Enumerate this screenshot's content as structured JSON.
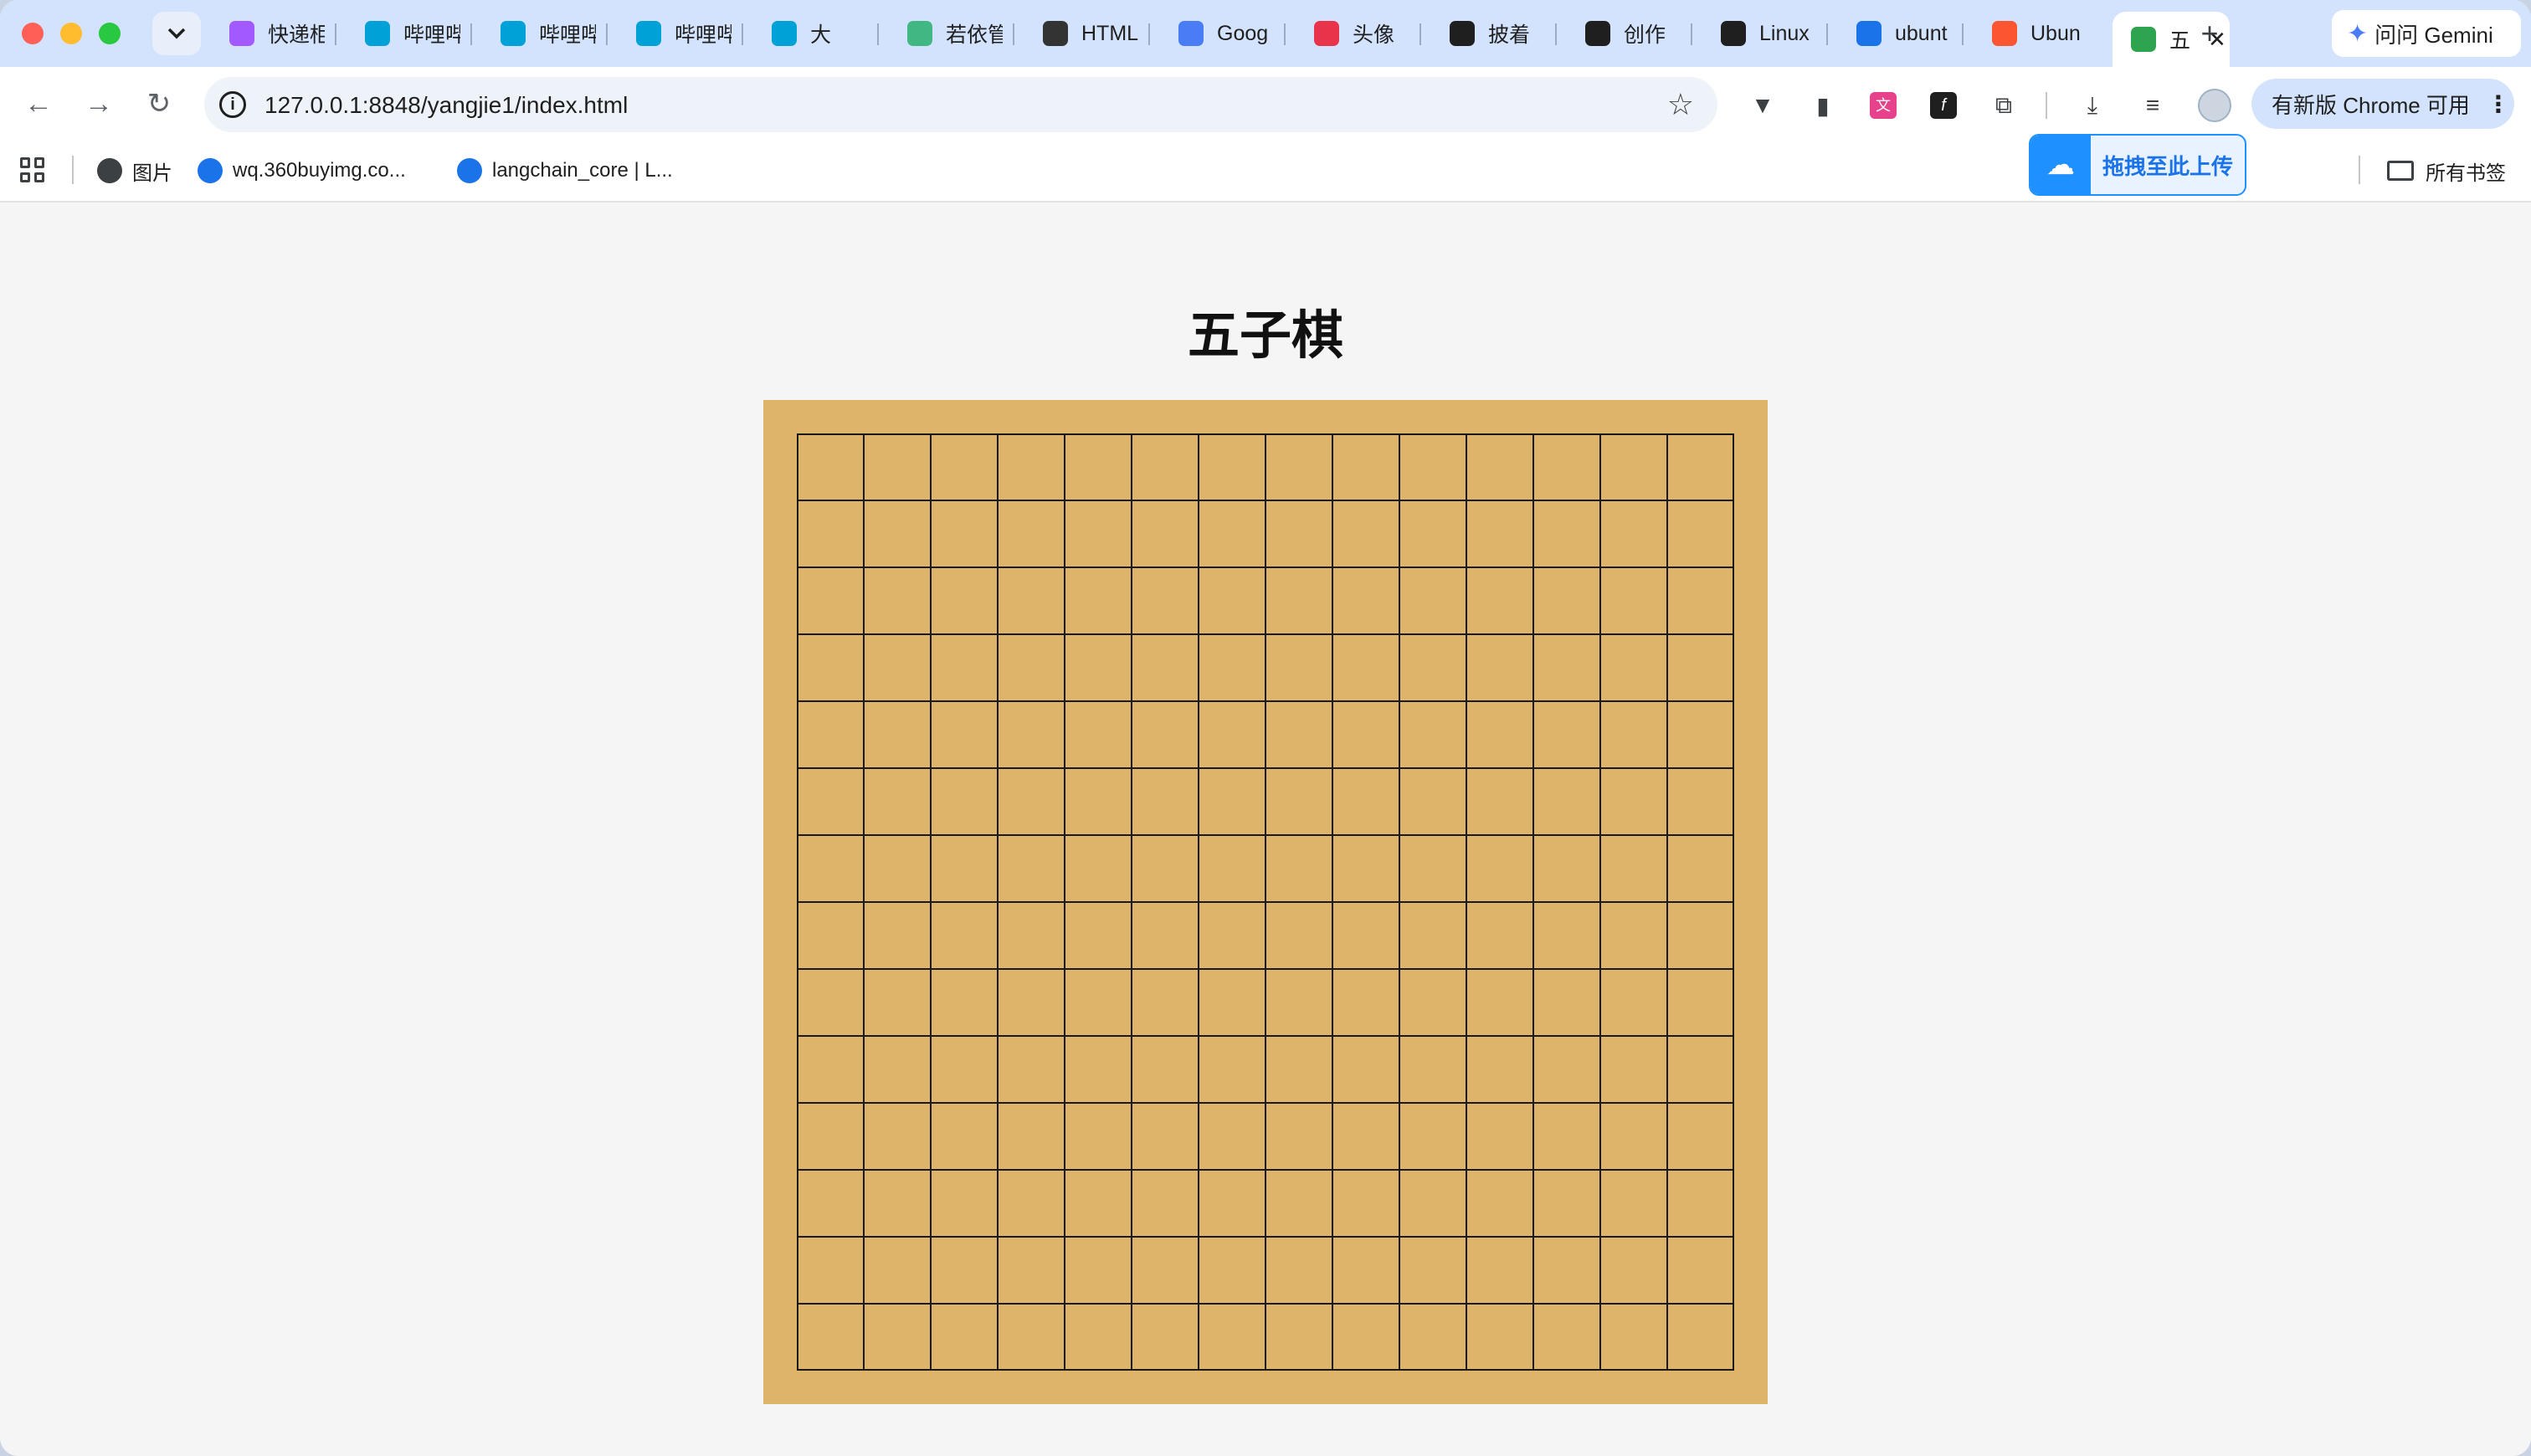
{
  "browser": {
    "tabs": [
      {
        "title": "快递柜",
        "favicon": "figma-icon",
        "color": "#a259ff"
      },
      {
        "title": "哔哩哔",
        "favicon": "bilibili-icon",
        "color": "#00a1d6"
      },
      {
        "title": "哔哩哔",
        "favicon": "bilibili-icon",
        "color": "#00a1d6"
      },
      {
        "title": "哔哩哔",
        "favicon": "bilibili-icon",
        "color": "#00a1d6"
      },
      {
        "title": "大",
        "favicon": "bilibili-icon",
        "color": "#00a1d6"
      },
      {
        "title": "若依管",
        "favicon": "ruoyi-icon",
        "color": "#41b883"
      },
      {
        "title": "HTML",
        "favicon": "openai-icon",
        "color": "#333333"
      },
      {
        "title": "Goog",
        "favicon": "gemini-icon",
        "color": "#4a7cf6"
      },
      {
        "title": "头像",
        "favicon": "avatar-site-icon",
        "color": "#e8334a"
      },
      {
        "title": "披着",
        "favicon": "robot-icon",
        "color": "#1f1f1f"
      },
      {
        "title": "创作",
        "favicon": "robot-icon",
        "color": "#1f1f1f"
      },
      {
        "title": "Linux",
        "favicon": "robot-icon",
        "color": "#1f1f1f"
      },
      {
        "title": "ubunt",
        "favicon": "search-icon",
        "color": "#1a73e8"
      },
      {
        "title": "Ubun",
        "favicon": "csdn-icon",
        "color": "#fc5531"
      },
      {
        "title": "五",
        "favicon": "hbuilder-icon",
        "color": "#2ea44f"
      }
    ],
    "gemini_label": "问问 Gemini",
    "url": "127.0.0.1:8848/yangjie1/index.html",
    "update_label": "有新版 Chrome 可用",
    "bookmarks": [
      {
        "label": "图片",
        "icon": "globe-icon",
        "color": "#3c4043"
      },
      {
        "label": "wq.360buyimg.co...",
        "icon": "stack-icon",
        "color": "#1a73e8"
      },
      {
        "label": "langchain_core | L...",
        "icon": "langchain-icon",
        "color": "#1a73e8"
      }
    ],
    "upload_label": "拖拽至此上传",
    "all_bookmarks_label": "所有书签"
  },
  "page": {
    "title": "五子棋"
  },
  "board": {
    "grid_lines": 15,
    "background_color": "#deb46a",
    "line_color": "#1a1a1a",
    "stones": []
  }
}
